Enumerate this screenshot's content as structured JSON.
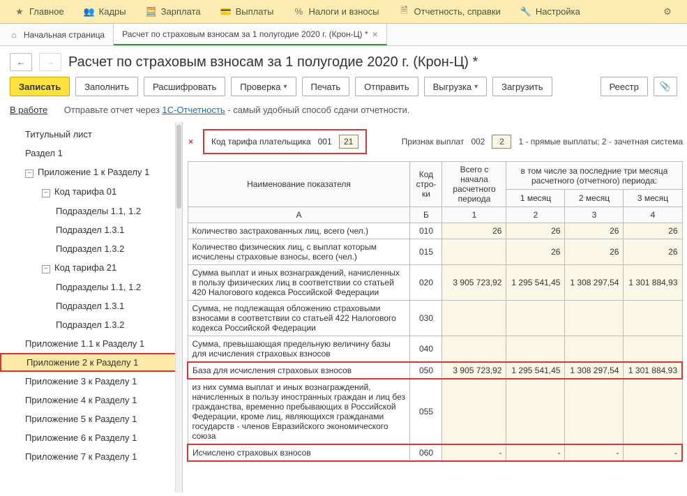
{
  "topmenu": {
    "main": "Главное",
    "hr": "Кадры",
    "salary": "Зарплата",
    "payments": "Выплаты",
    "taxes": "Налоги и взносы",
    "reports": "Отчетность, справки",
    "settings": "Настройка"
  },
  "pagetabs": {
    "home": "Начальная страница",
    "tab1": "Расчет по страховым взносам за 1 полугодие 2020 г. (Крон-Ц) *"
  },
  "title": "Расчет по страховым взносам за 1 полугодие 2020 г. (Крон-Ц) *",
  "toolbar": {
    "save": "Записать",
    "fill": "Заполнить",
    "decode": "Расшифровать",
    "check": "Проверка",
    "print": "Печать",
    "send": "Отправить",
    "export": "Выгрузка",
    "import": "Загрузить",
    "registry": "Реестр"
  },
  "status": {
    "inwork": "В работе",
    "prefix": "Отправьте отчет через ",
    "link": "1С-Отчетность",
    "suffix": " - самый удобный способ сдачи отчетности."
  },
  "tree": {
    "titlepage": "Титульный лист",
    "sec1": "Раздел 1",
    "app1": "Приложение 1 к Разделу 1",
    "t01": "Код тарифа 01",
    "sub11_12a": "Подразделы 1.1, 1.2",
    "sub131a": "Подраздел 1.3.1",
    "sub132a": "Подраздел 1.3.2",
    "t21": "Код тарифа 21",
    "sub11_12b": "Подразделы 1.1, 1.2",
    "sub131b": "Подраздел 1.3.1",
    "sub132b": "Подраздел 1.3.2",
    "app11": "Приложение 1.1 к Разделу 1",
    "app2": "Приложение 2 к Разделу 1",
    "app3": "Приложение 3 к Разделу 1",
    "app4": "Приложение 4 к Разделу 1",
    "app5": "Приложение 5 к Разделу 1",
    "app6": "Приложение 6 к Разделу 1",
    "app7": "Приложение 7 к Разделу 1"
  },
  "hdr": {
    "tariff_label": "Код тарифа плательщика",
    "tariff_code": "001",
    "tariff_val": "21",
    "sign_label": "Признак выплат",
    "sign_code": "002",
    "sign_val": "2",
    "sign_hint": "1 - прямые выплаты; 2 - зачетная система"
  },
  "table": {
    "head": {
      "name": "Наименование показателя",
      "line": "Код стро­ки",
      "total": "Всего с начала расчетного периода",
      "last3": "в том числе за последние три месяца расчетного (отчетного) периода:",
      "m1": "1 месяц",
      "m2": "2 месяц",
      "m3": "3 месяц",
      "colA": "А",
      "colB": "Б",
      "col1": "1",
      "col2": "2",
      "col3": "3",
      "col4": "4"
    },
    "rows": [
      {
        "name": "Количество застрахованных лиц, всего (чел.)",
        "code": "010",
        "total": "26",
        "m1": "26",
        "m2": "26",
        "m3": "26"
      },
      {
        "name": "Количество физических лиц, с выплат которым исчислены страховые взносы, всего (чел.)",
        "code": "015",
        "total": "",
        "m1": "26",
        "m2": "26",
        "m3": "26"
      },
      {
        "name": "Сумма выплат и иных вознаграждений, начисленных в пользу физических лиц в соответствии со статьей 420 Налогового кодекса Российской Федерации",
        "code": "020",
        "total": "3 905 723,92",
        "m1": "1 295 541,45",
        "m2": "1 308 297,54",
        "m3": "1 301 884,93"
      },
      {
        "name": "Сумма, не подлежащая обложению страховыми взносами в соответствии со статьей 422 Налогового кодекса Российской Федерации",
        "code": "030",
        "total": "",
        "m1": "",
        "m2": "",
        "m3": ""
      },
      {
        "name": "Сумма, превышающая предельную величину базы для исчисления страховых взносов",
        "code": "040",
        "total": "",
        "m1": "",
        "m2": "",
        "m3": ""
      },
      {
        "name": "База для исчисления страховых взносов",
        "code": "050",
        "total": "3 905 723,92",
        "m1": "1 295 541,45",
        "m2": "1 308 297,54",
        "m3": "1 301 884,93"
      },
      {
        "name": "из них сумма выплат и иных вознаграждений, начисленных в пользу иностранных граждан и лиц без гражданства, временно пребывающих в Российской Федерации, кроме лиц, являющихся гражданами государств - членов Евразийского экономического союза",
        "code": "055",
        "total": "",
        "m1": "",
        "m2": "",
        "m3": ""
      },
      {
        "name": "Исчислено страховых взносов",
        "code": "060",
        "total": "-",
        "m1": "-",
        "m2": "-",
        "m3": "-"
      }
    ]
  }
}
